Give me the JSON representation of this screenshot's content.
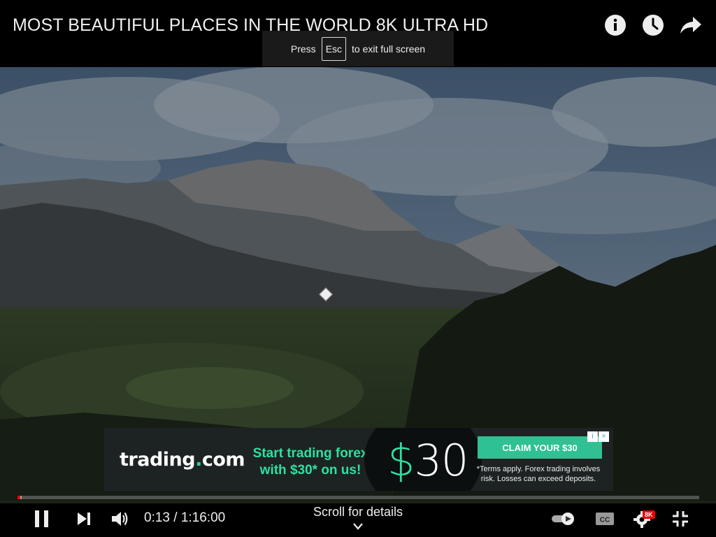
{
  "video": {
    "title": "MOST BEAUTIFUL PLACES IN THE WORLD 8K ULTRA HD"
  },
  "toast": {
    "prefix": "Press",
    "key": "Esc",
    "suffix": "to exit full screen"
  },
  "top_icons": [
    "info-icon",
    "clock-icon",
    "share-icon"
  ],
  "ad": {
    "logo_main": "trading",
    "logo_dot": ".",
    "logo_tld": "com",
    "headline": "Start trading forex with $30* on us!",
    "amount_symbol": "$",
    "amount_value": "30",
    "cta": "CLAIM YOUR $30",
    "terms": "*Terms apply. Forex trading involves risk. Losses can exceed deposits.",
    "badge_info": "i",
    "badge_close": "×",
    "accent_color": "#2fe0a0"
  },
  "player": {
    "current_time": "0:13",
    "duration": "1:16:00",
    "time_display": "0:13 / 1:16:00",
    "played_fraction": 0.0029,
    "buffered_fraction": 0.0049,
    "scroll_hint": "Scroll for details",
    "quality_badge": "8K",
    "progress_color": "#ff0000",
    "controls": [
      "pause-icon",
      "next-icon",
      "volume-icon",
      "autoplay-toggle",
      "captions-icon",
      "settings-icon",
      "exit-fullscreen-icon"
    ]
  }
}
